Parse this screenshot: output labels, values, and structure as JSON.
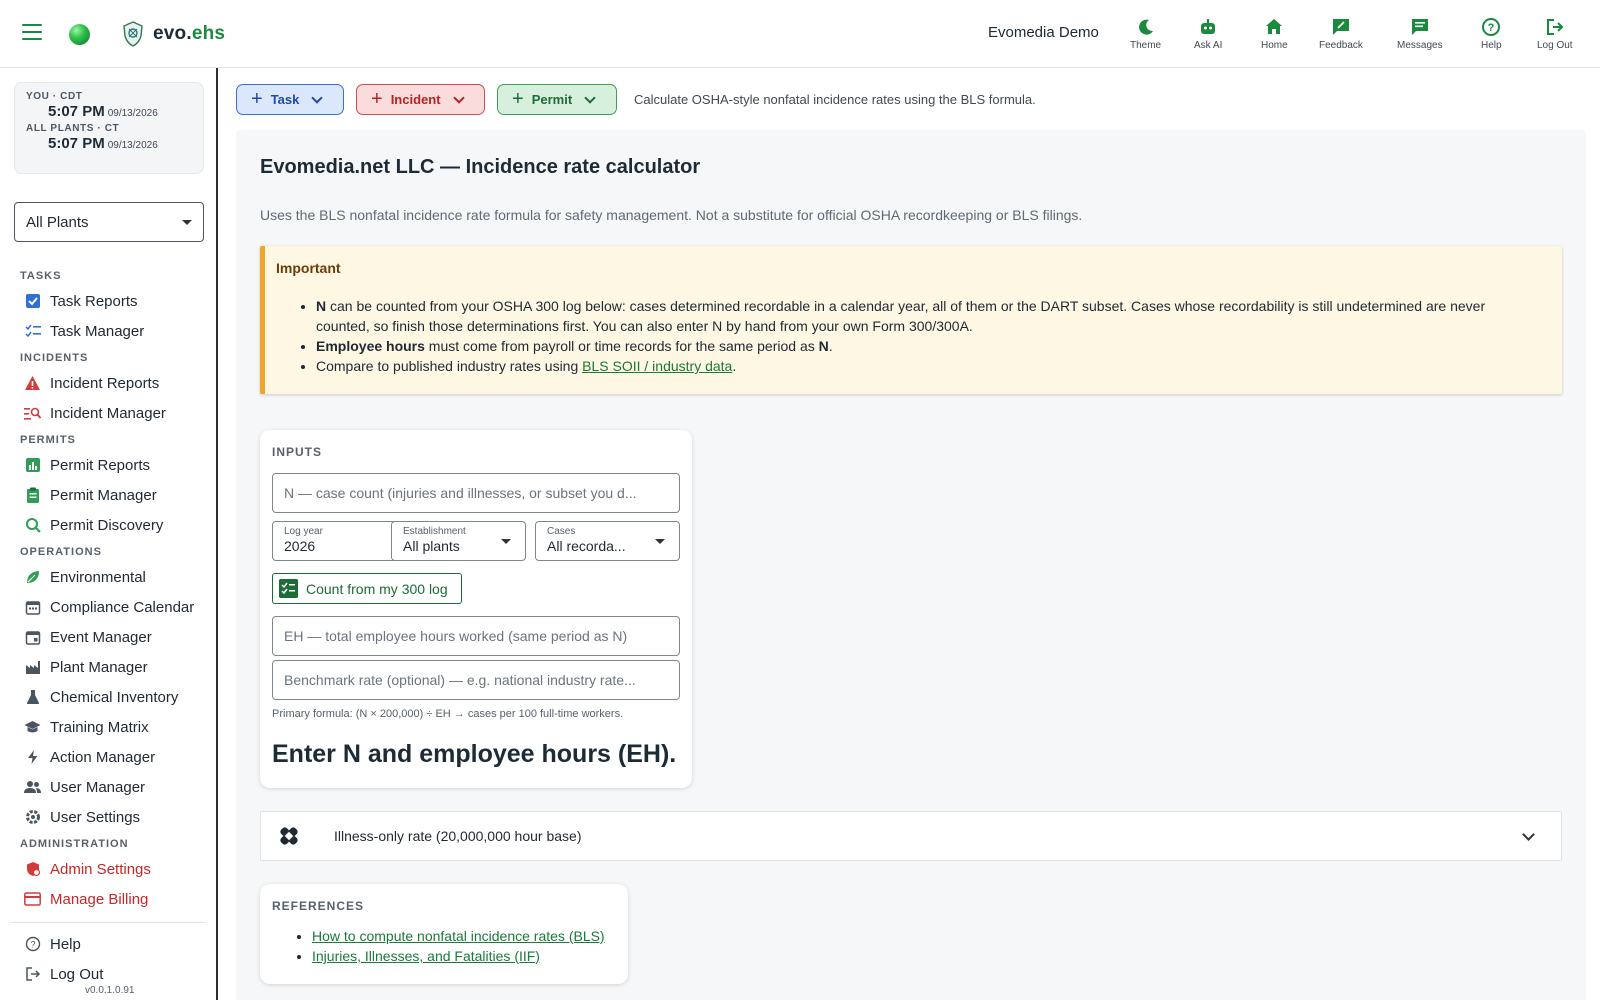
{
  "app": {
    "brand_prefix": "evo.",
    "brand_suffix": "ehs",
    "org_name": "Evomedia Demo"
  },
  "topnav": [
    {
      "label": "Theme",
      "icon": "moon-icon"
    },
    {
      "label": "Ask AI",
      "icon": "robot-icon"
    },
    {
      "label": "Home",
      "icon": "home-icon"
    },
    {
      "label": "Feedback",
      "icon": "feedback-icon"
    },
    {
      "label": "Messages",
      "icon": "messages-icon"
    },
    {
      "label": "Help",
      "icon": "help-icon"
    },
    {
      "label": "Log Out",
      "icon": "logout-icon"
    }
  ],
  "clock": {
    "you_label": "YOU · CDT",
    "you_time": "5:07 PM",
    "you_date": "09/13/2026",
    "plants_label": "ALL PLANTS · CT",
    "plants_time": "5:07 PM",
    "plants_date": "09/13/2026"
  },
  "plant_select": {
    "value": "All Plants"
  },
  "sidebar": {
    "sections": {
      "tasks": "TASKS",
      "incidents": "INCIDENTS",
      "permits": "PERMITS",
      "operations": "OPERATIONS",
      "administration": "ADMINISTRATION"
    },
    "items": {
      "task_reports": "Task Reports",
      "task_manager": "Task Manager",
      "incident_reports": "Incident Reports",
      "incident_manager": "Incident Manager",
      "permit_reports": "Permit Reports",
      "permit_manager": "Permit Manager",
      "permit_discovery": "Permit Discovery",
      "environmental": "Environmental",
      "compliance_calendar": "Compliance Calendar",
      "event_manager": "Event Manager",
      "plant_manager": "Plant Manager",
      "chemical_inventory": "Chemical Inventory",
      "training_matrix": "Training Matrix",
      "action_manager": "Action Manager",
      "user_manager": "User Manager",
      "user_settings": "User Settings",
      "admin_settings": "Admin Settings",
      "manage_billing": "Manage Billing",
      "help": "Help",
      "log_out": "Log Out"
    },
    "version": "v0.0.1.0.91"
  },
  "actionbar": {
    "task": "Task",
    "incident": "Incident",
    "permit": "Permit",
    "hint": "Calculate OSHA-style nonfatal incidence rates using the BLS formula."
  },
  "page": {
    "title": "Evomedia.net LLC — Incidence rate calculator",
    "subtitle": "Uses the BLS nonfatal incidence rate formula for safety management. Not a substitute for official OSHA recordkeeping or BLS filings."
  },
  "callout": {
    "heading": "Important",
    "b1_bold": "N",
    "b1_text": " can be counted from your OSHA 300 log below: cases determined recordable in a calendar year, all of them or the DART subset. Cases whose recordability is still undetermined are never counted, so finish those determinations first. You can also enter N by hand from your own Form 300/300A.",
    "b2_bold": "Employee hours",
    "b2_text": " must come from payroll or time records for the same period as ",
    "b2_bold2": "N",
    "b2_end": ".",
    "b3_text": "Compare to published industry rates using ",
    "b3_link": "BLS SOII / industry data",
    "b3_end": "."
  },
  "inputs": {
    "label": "INPUTS",
    "n_placeholder": "N — case count (injuries and illnesses, or subset you d...",
    "log_year_label": "Log year",
    "log_year_value": "2026",
    "establishment_label": "Establishment",
    "establishment_value": "All plants",
    "cases_label": "Cases",
    "cases_value": "All recorda...",
    "count_button": "Count from my 300 log",
    "eh_placeholder": "EH — total employee hours worked (same period as N)",
    "benchmark_placeholder": "Benchmark rate (optional) — e.g. national industry rate...",
    "formula": "Primary formula: (N × 200,000) ÷ EH → cases per 100 full-time workers.",
    "result": "Enter N and employee hours (EH)."
  },
  "accordion": {
    "title": "Illness-only rate (20,000,000 hour base)"
  },
  "references": {
    "label": "REFERENCES",
    "link1": "How to compute nonfatal incidence rates (BLS)",
    "link2": "Injuries, Illnesses, and Fatalities (IIF)"
  },
  "colors": {
    "brand_green": "#1a8a3c",
    "task_blue": "#3a6fd8",
    "incident_red": "#d54a4a",
    "permit_green": "#3d9d5a",
    "callout_accent": "#f0a526",
    "admin_red": "#c62828"
  }
}
